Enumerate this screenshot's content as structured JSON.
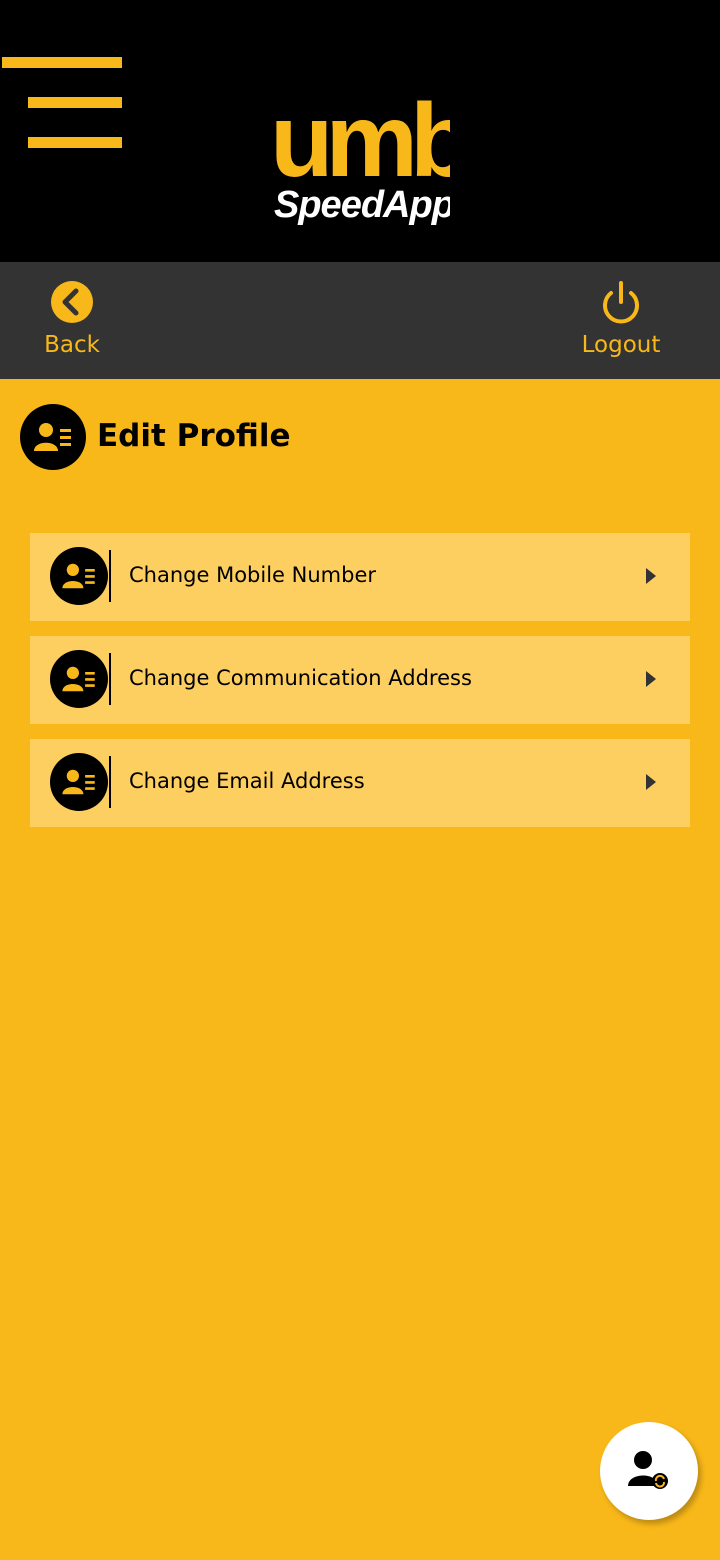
{
  "header": {
    "logo_text_top": "umb",
    "logo_text_bottom": "SpeedApp",
    "menu_icon": "hamburger-menu-icon"
  },
  "action_bar": {
    "back_label": "Back",
    "logout_label": "Logout"
  },
  "page": {
    "title": "Edit Profile",
    "title_icon": "profile-card-icon"
  },
  "options": [
    {
      "label": "Change Mobile Number",
      "icon": "profile-card-icon"
    },
    {
      "label": "Change Communication Address",
      "icon": "profile-card-icon"
    },
    {
      "label": "Change Email Address",
      "icon": "profile-card-icon"
    }
  ],
  "fab": {
    "icon": "user-refresh-icon"
  },
  "colors": {
    "brand_yellow": "#f9b81a",
    "row_background": "#fdce60",
    "header_black": "#000000",
    "action_bar_gray": "#333333"
  }
}
